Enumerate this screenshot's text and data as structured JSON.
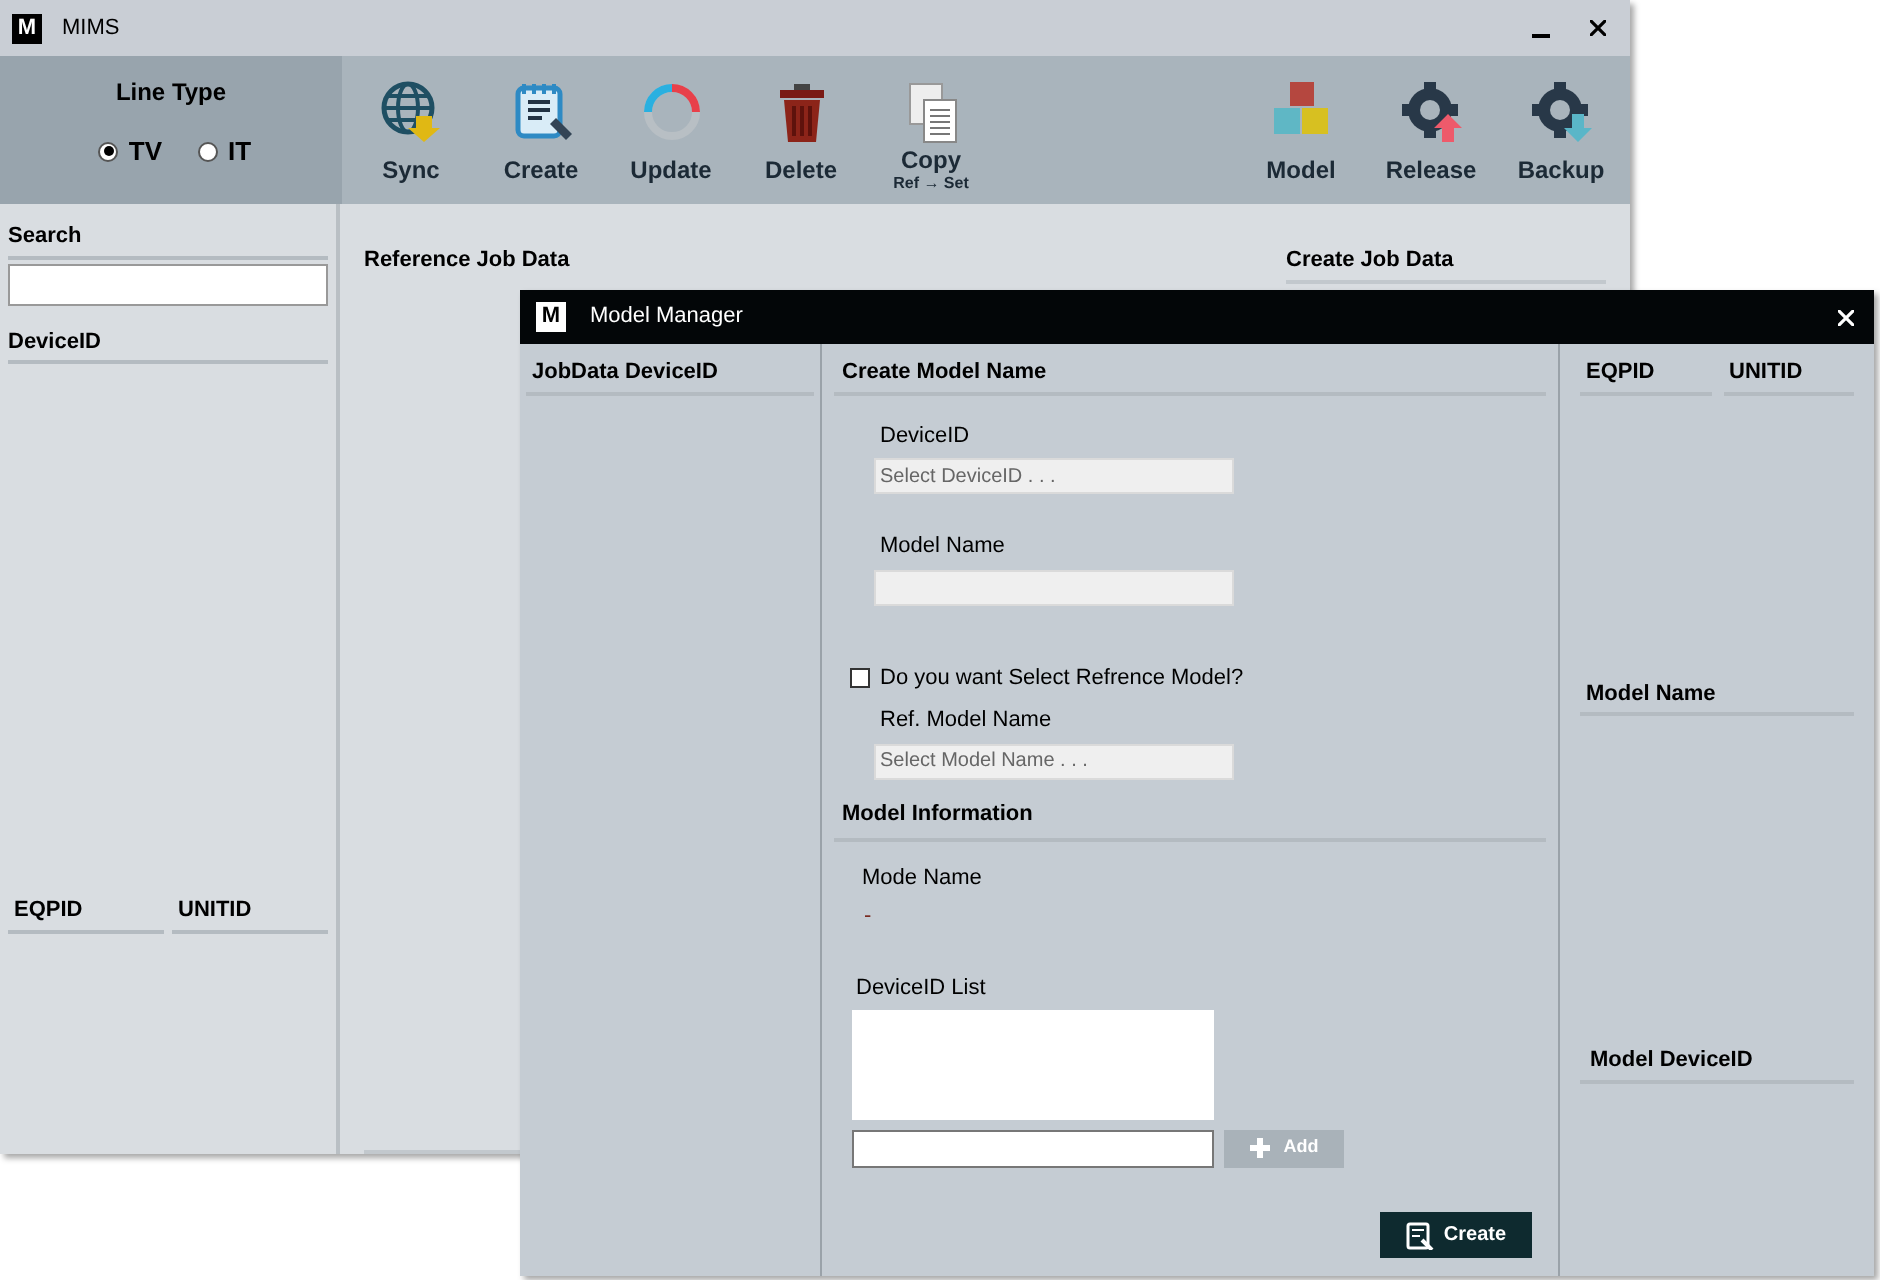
{
  "main_window": {
    "title": "MIMS",
    "logo": "M",
    "line_type": {
      "label": "Line Type",
      "options": [
        {
          "label": "TV",
          "selected": true
        },
        {
          "label": "IT",
          "selected": false
        }
      ]
    },
    "toolbar_left": [
      {
        "kind": "globe",
        "label": "Sync"
      },
      {
        "kind": "notepad",
        "label": "Create"
      },
      {
        "kind": "ring",
        "label": "Update"
      },
      {
        "kind": "trash",
        "label": "Delete"
      },
      {
        "kind": "copy",
        "label": "Copy",
        "sublabel": "Ref → Set"
      }
    ],
    "toolbar_right": [
      {
        "kind": "cubes",
        "label": "Model"
      },
      {
        "kind": "gear-up",
        "label": "Release"
      },
      {
        "kind": "gear-down",
        "label": "Backup"
      }
    ],
    "sidebar": {
      "search_label": "Search",
      "device_header": "DeviceID",
      "columns": [
        "EQPID",
        "UNITID"
      ]
    },
    "content": {
      "reference_header": "Reference Job Data",
      "create_header": "Create Job Data"
    }
  },
  "dialog": {
    "title": "Model Manager",
    "logo": "M",
    "left_header": "JobData DeviceID",
    "create_section": "Create Model Name",
    "fields": [
      {
        "label": "DeviceID",
        "placeholder": "Select DeviceID . . ."
      },
      {
        "label": "Model Name"
      }
    ],
    "reference_checkbox": {
      "label": "Do you want Select Refrence Model?",
      "checked": false
    },
    "ref_field": {
      "label": "Ref. Model Name",
      "placeholder": "Select Model Name . . ."
    },
    "info_section": "Model Information",
    "mode_name": {
      "label": "Mode Name",
      "value": "-"
    },
    "device_list_label": "DeviceID List",
    "add_button": "Add",
    "create_button": "Create",
    "right": {
      "columns": [
        "EQPID",
        "UNITID"
      ],
      "model_name_header": "Model Name",
      "model_device_header": "Model DeviceID"
    }
  }
}
